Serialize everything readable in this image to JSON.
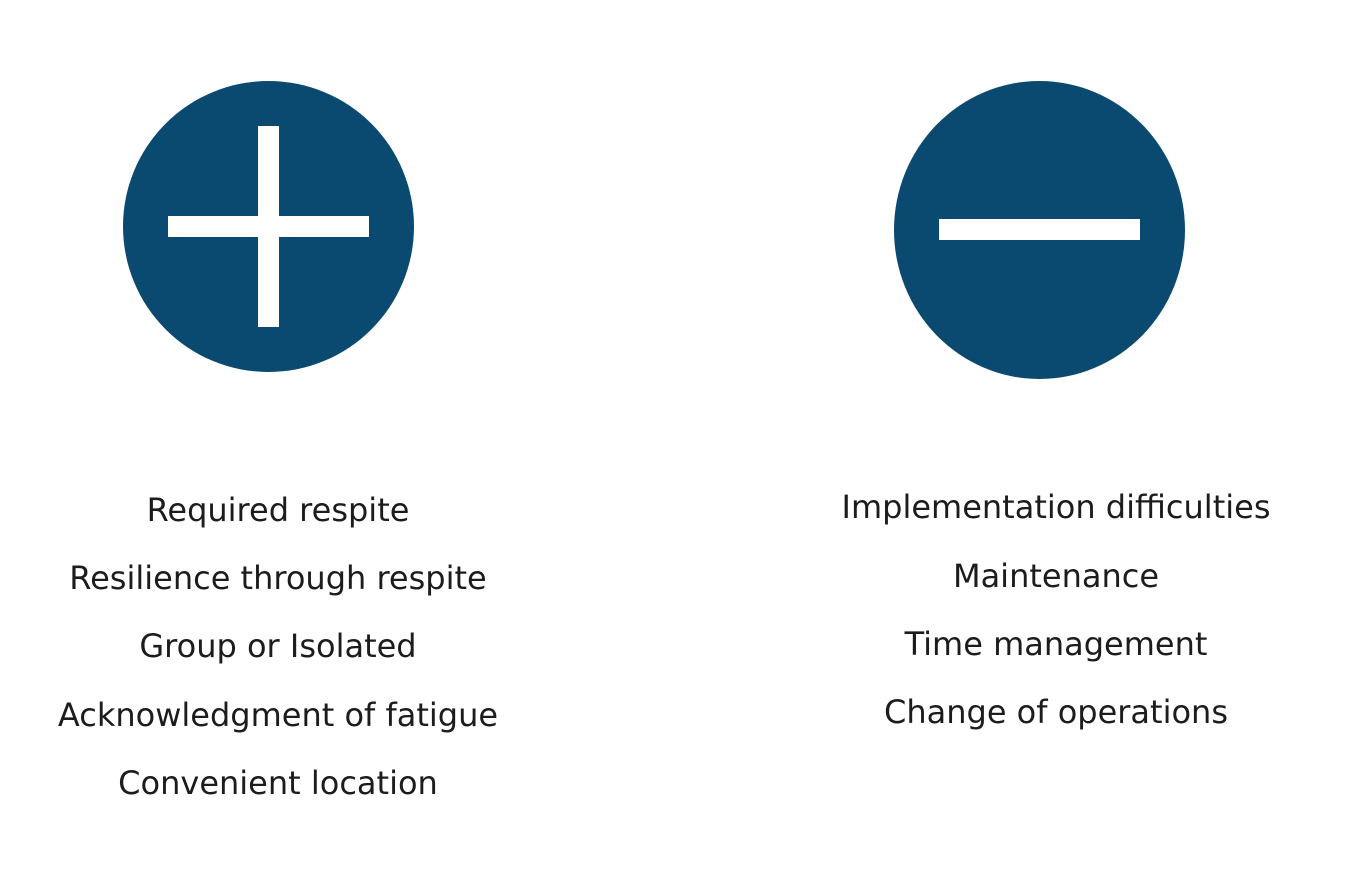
{
  "colors": {
    "icon_fill": "#0b4a70",
    "icon_symbol": "#ffffff",
    "text": "#1c1c1c",
    "background": "#ffffff"
  },
  "pros": {
    "icon": "plus-icon",
    "items": [
      "Required respite",
      "Resilience through respite",
      "Group or Isolated",
      "Acknowledgment of fatigue",
      "Convenient location"
    ]
  },
  "cons": {
    "icon": "minus-icon",
    "items": [
      "Implementation difficulties",
      "Maintenance",
      "Time management",
      "Change of operations"
    ]
  }
}
